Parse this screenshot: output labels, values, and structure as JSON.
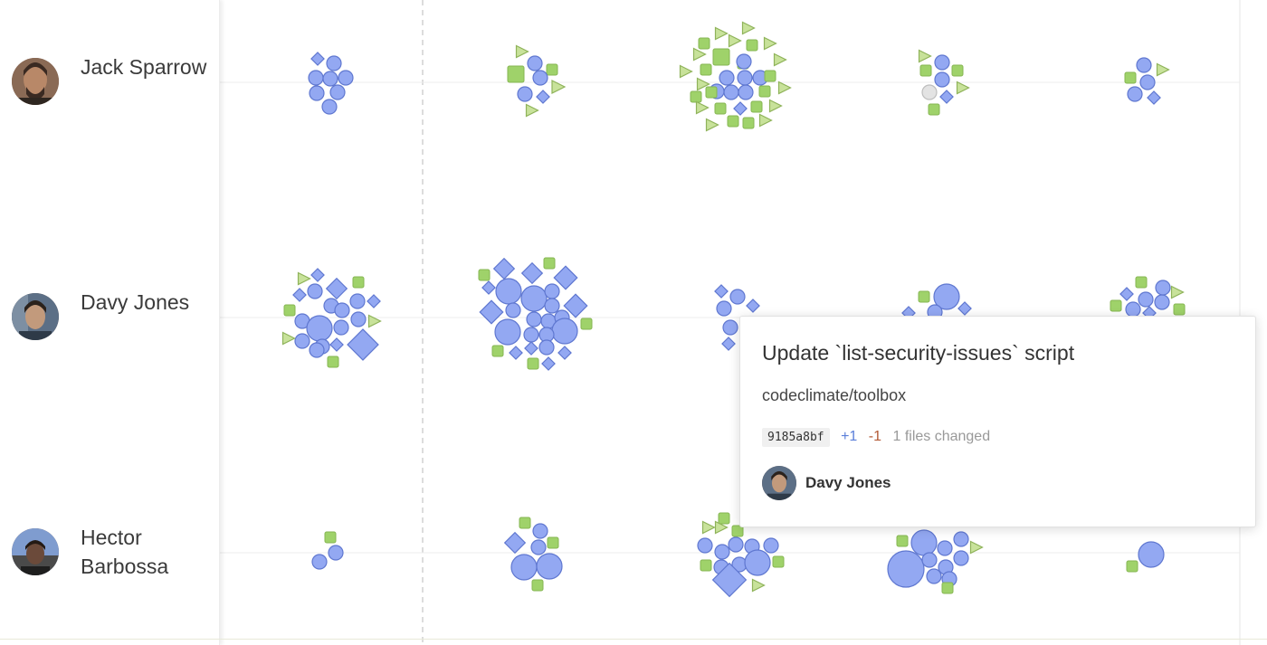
{
  "people": [
    {
      "name": "Jack Sparrow"
    },
    {
      "name": "Davy Jones"
    },
    {
      "name": "Hector Barbossa"
    }
  ],
  "legend_shapes": {
    "circle": "commit",
    "diamond": "commit",
    "square": "commit",
    "triangle": "commit"
  },
  "colors": {
    "blue_fill": "#93a8f2",
    "blue_stroke": "#5f77d0",
    "green_fill": "#9fd26a",
    "green_stroke": "#86b652",
    "triangle_fill": "#c8e29a",
    "triangle_stroke": "#8fb35a",
    "gray_fill": "#e3e3e3"
  },
  "tooltip": {
    "title": "Update `list-security-issues` script",
    "repo": "codeclimate/toolbox",
    "sha": "9185a8bf",
    "additions": "+1",
    "deletions": "-1",
    "files_changed": "1 files changed",
    "author": "Davy Jones"
  }
}
